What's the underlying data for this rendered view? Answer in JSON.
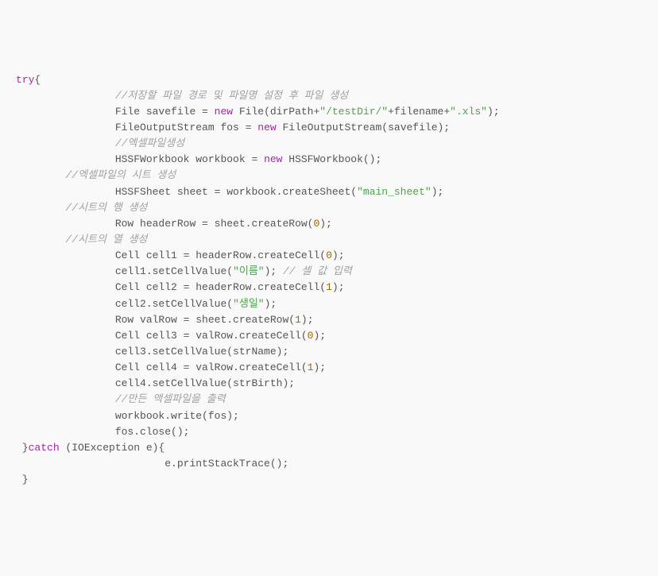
{
  "code": {
    "lines": [
      {
        "indent": 0,
        "parts": [
          {
            "t": "kw",
            "v": "try"
          },
          {
            "t": "plain",
            "v": "{"
          }
        ]
      },
      {
        "indent": 2,
        "parts": [
          {
            "t": "com",
            "v": "//저장할 파일 경로 및 파일명 설정 후 파일 생성"
          }
        ]
      },
      {
        "indent": 2,
        "parts": [
          {
            "t": "plain",
            "v": "File savefile = "
          },
          {
            "t": "kw",
            "v": "new"
          },
          {
            "t": "plain",
            "v": " File(dirPath+"
          },
          {
            "t": "str",
            "v": "\"/testDir/\""
          },
          {
            "t": "plain",
            "v": "+filename+"
          },
          {
            "t": "str",
            "v": "\".xls\""
          },
          {
            "t": "plain",
            "v": ");"
          }
        ]
      },
      {
        "indent": 2,
        "parts": [
          {
            "t": "plain",
            "v": "FileOutputStream fos = "
          },
          {
            "t": "kw",
            "v": "new"
          },
          {
            "t": "plain",
            "v": " FileOutputStream(savefile);"
          }
        ]
      },
      {
        "indent": 0,
        "parts": [
          {
            "t": "plain",
            "v": ""
          }
        ]
      },
      {
        "indent": 2,
        "parts": [
          {
            "t": "com",
            "v": "//엑셀파일생성"
          }
        ]
      },
      {
        "indent": 2,
        "parts": [
          {
            "t": "plain",
            "v": "HSSFWorkbook workbook = "
          },
          {
            "t": "kw",
            "v": "new"
          },
          {
            "t": "plain",
            "v": " HSSFWorkbook();"
          }
        ]
      },
      {
        "indent": 1,
        "parts": [
          {
            "t": "com",
            "v": "//엑셀파일의 시트 생성"
          }
        ]
      },
      {
        "indent": 2,
        "parts": [
          {
            "t": "plain",
            "v": "HSSFSheet sheet = workbook.createSheet("
          },
          {
            "t": "str",
            "v": "\"main_sheet\""
          },
          {
            "t": "plain",
            "v": ");"
          }
        ]
      },
      {
        "indent": 0,
        "parts": [
          {
            "t": "plain",
            "v": ""
          }
        ]
      },
      {
        "indent": 1,
        "parts": [
          {
            "t": "com",
            "v": "//시트의 행 생성"
          }
        ]
      },
      {
        "indent": 2,
        "parts": [
          {
            "t": "plain",
            "v": "Row headerRow = sheet.createRow("
          },
          {
            "t": "num",
            "v": "0"
          },
          {
            "t": "plain",
            "v": ");"
          }
        ]
      },
      {
        "indent": 0,
        "parts": [
          {
            "t": "plain",
            "v": ""
          }
        ]
      },
      {
        "indent": 1,
        "parts": [
          {
            "t": "com",
            "v": "//시트의 열 생성"
          }
        ]
      },
      {
        "indent": 2,
        "parts": [
          {
            "t": "plain",
            "v": "Cell cell1 = headerRow.createCell("
          },
          {
            "t": "num",
            "v": "0"
          },
          {
            "t": "plain",
            "v": ");"
          }
        ]
      },
      {
        "indent": 2,
        "parts": [
          {
            "t": "plain",
            "v": "cell1.setCellValue("
          },
          {
            "t": "str",
            "v": "\"이름\""
          },
          {
            "t": "plain",
            "v": "); "
          },
          {
            "t": "com",
            "v": "// 셀 값 입력"
          }
        ]
      },
      {
        "indent": 2,
        "parts": [
          {
            "t": "plain",
            "v": "Cell cell2 = headerRow.createCell("
          },
          {
            "t": "num",
            "v": "1"
          },
          {
            "t": "plain",
            "v": ");"
          }
        ]
      },
      {
        "indent": 2,
        "parts": [
          {
            "t": "plain",
            "v": "cell2.setCellValue("
          },
          {
            "t": "str",
            "v": "\"생일\""
          },
          {
            "t": "plain",
            "v": ");"
          }
        ]
      },
      {
        "indent": 0,
        "parts": [
          {
            "t": "plain",
            "v": ""
          }
        ]
      },
      {
        "indent": 2,
        "parts": [
          {
            "t": "plain",
            "v": "Row valRow = sheet.createRow("
          },
          {
            "t": "num",
            "v": "1"
          },
          {
            "t": "plain",
            "v": ");"
          }
        ]
      },
      {
        "indent": 2,
        "parts": [
          {
            "t": "plain",
            "v": "Cell cell3 = valRow.createCell("
          },
          {
            "t": "num",
            "v": "0"
          },
          {
            "t": "plain",
            "v": ");"
          }
        ]
      },
      {
        "indent": 2,
        "parts": [
          {
            "t": "plain",
            "v": "cell3.setCellValue(strName);"
          }
        ]
      },
      {
        "indent": 2,
        "parts": [
          {
            "t": "plain",
            "v": "Cell cell4 = valRow.createCell("
          },
          {
            "t": "num",
            "v": "1"
          },
          {
            "t": "plain",
            "v": ");"
          }
        ]
      },
      {
        "indent": 2,
        "parts": [
          {
            "t": "plain",
            "v": "cell4.setCellValue(strBirth);"
          }
        ]
      },
      {
        "indent": 0,
        "parts": [
          {
            "t": "plain",
            "v": ""
          }
        ]
      },
      {
        "indent": 2,
        "parts": [
          {
            "t": "com",
            "v": "//만든 액셀파일을 출력"
          }
        ]
      },
      {
        "indent": 2,
        "parts": [
          {
            "t": "plain",
            "v": "workbook.write(fos);"
          }
        ]
      },
      {
        "indent": 2,
        "parts": [
          {
            "t": "plain",
            "v": "fos.close();"
          }
        ]
      },
      {
        "indent": 0,
        "parts": [
          {
            "t": "plain",
            "v": " }"
          },
          {
            "t": "kw",
            "v": "catch"
          },
          {
            "t": "plain",
            "v": " (IOException e){"
          }
        ]
      },
      {
        "indent": 3,
        "parts": [
          {
            "t": "plain",
            "v": "e.printStackTrace();"
          }
        ]
      },
      {
        "indent": 0,
        "parts": [
          {
            "t": "plain",
            "v": " }"
          }
        ]
      }
    ]
  }
}
